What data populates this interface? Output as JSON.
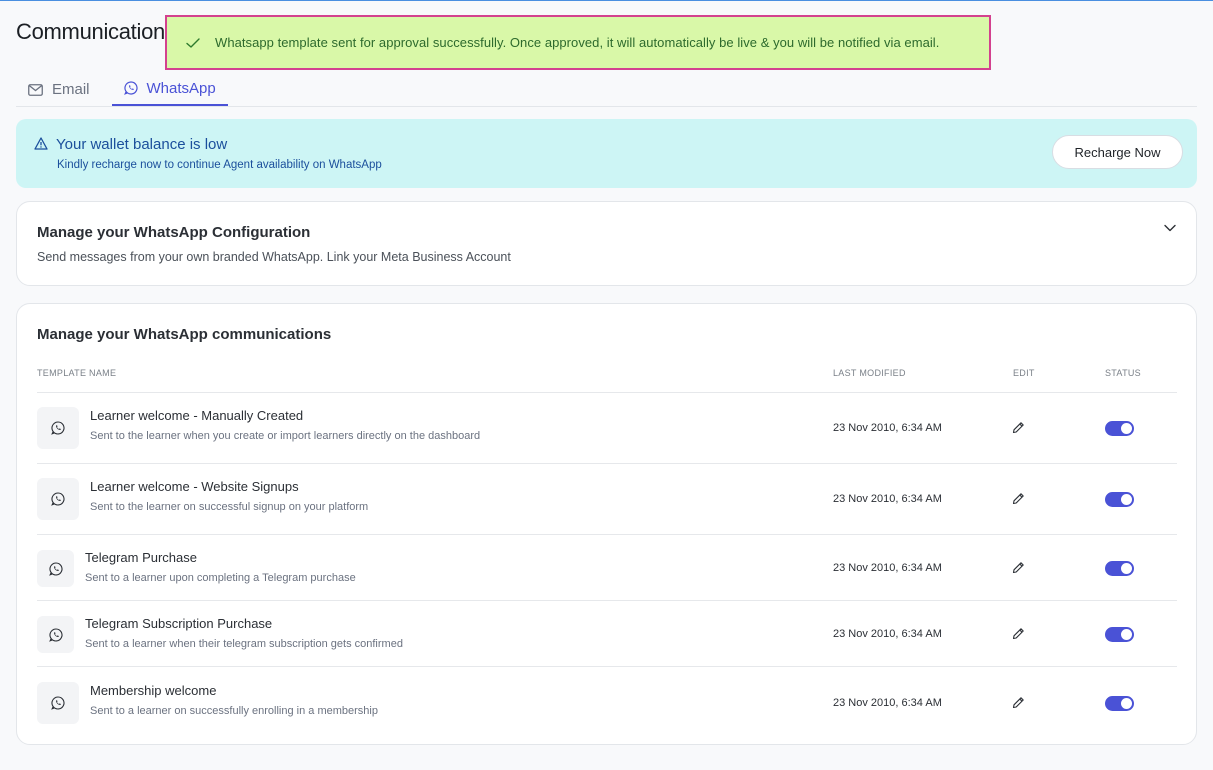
{
  "page": {
    "title": "Communications"
  },
  "toast": {
    "message": "Whatsapp template sent for approval successfully. Once approved, it will automatically be live & you will be notified via email."
  },
  "tabs": [
    {
      "label": "Email",
      "icon": "mail-icon",
      "active": false
    },
    {
      "label": "WhatsApp",
      "icon": "whatsapp-icon",
      "active": true
    }
  ],
  "wallet": {
    "title": "Your wallet balance is low",
    "subtitle": "Kindly recharge now to continue Agent availability on WhatsApp",
    "button_label": "Recharge Now"
  },
  "config": {
    "title": "Manage your WhatsApp Configuration",
    "subtitle": "Send messages from your own branded WhatsApp. Link your Meta Business Account"
  },
  "comms": {
    "title": "Manage your WhatsApp communications",
    "columns": {
      "name": "TEMPLATE NAME",
      "modified": "LAST MODIFIED",
      "edit": "EDIT",
      "status": "STATUS"
    },
    "rows": [
      {
        "name": "Learner welcome - Manually Created",
        "desc": "Sent to the learner when you create or import learners directly on the dashboard",
        "modified": "23 Nov 2010, 6:34 AM",
        "enabled": true
      },
      {
        "name": "Learner welcome - Website Signups",
        "desc": "Sent to the learner on successful signup on your platform",
        "modified": "23 Nov 2010, 6:34 AM",
        "enabled": true
      },
      {
        "name": "Telegram Purchase",
        "desc": "Sent to a learner upon completing a Telegram purchase",
        "modified": "23 Nov 2010, 6:34 AM",
        "enabled": true
      },
      {
        "name": "Telegram Subscription Purchase",
        "desc": "Sent to a learner when their telegram subscription gets confirmed",
        "modified": "23 Nov 2010, 6:34 AM",
        "enabled": true
      },
      {
        "name": "Membership welcome",
        "desc": "Sent to a learner on successfully enrolling in a membership",
        "modified": "23 Nov 2010, 6:34 AM",
        "enabled": true
      }
    ]
  },
  "colors": {
    "accent": "#4a52d6",
    "toast_bg": "#d9f8a8",
    "toast_border": "#d3418f",
    "wallet_bg": "#cdf5f5"
  }
}
